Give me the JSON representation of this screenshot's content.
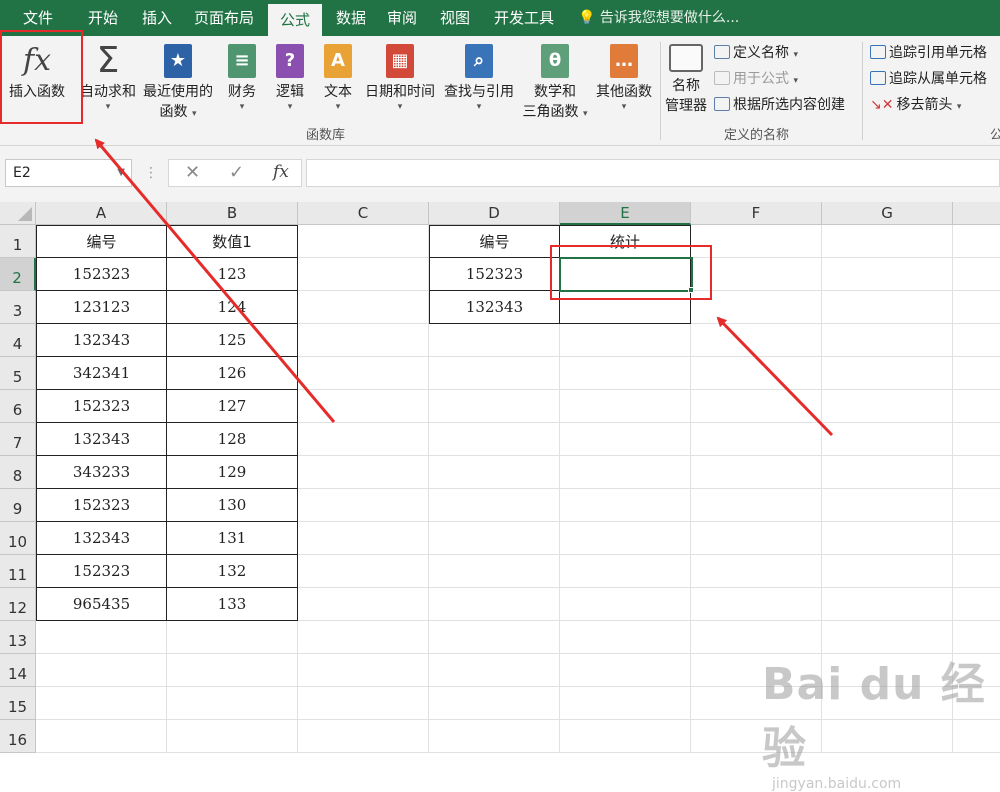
{
  "menu_tabs": [
    {
      "label": "文件"
    },
    {
      "label": "开始"
    },
    {
      "label": "插入"
    },
    {
      "label": "页面布局"
    },
    {
      "label": "公式",
      "active": true
    },
    {
      "label": "数据"
    },
    {
      "label": "审阅"
    },
    {
      "label": "视图"
    },
    {
      "label": "开发工具"
    }
  ],
  "tell_me": "告诉我您想要做什么...",
  "ribbon": {
    "function_library": {
      "group_label": "函数库",
      "insert_function": "插入函数",
      "insert_function_icon": "fx",
      "autosum": "自动求和",
      "recently_used_line1": "最近使用的",
      "recently_used_line2": "函数",
      "financial": "财务",
      "logical": "逻辑",
      "text": "文本",
      "datetime": "日期和时间",
      "lookup": "查找与引用",
      "math_line1": "数学和",
      "math_line2": "三角函数",
      "more": "其他函数"
    },
    "defined_names": {
      "group_label": "定义的名称",
      "name_manager_line1": "名称",
      "name_manager_line2": "管理器",
      "define_name": "定义名称",
      "use_in_formula": "用于公式",
      "create_from_selection": "根据所选内容创建"
    },
    "auditing": {
      "trace_precedents": "追踪引用单元格",
      "trace_dependents": "追踪从属单元格",
      "remove_arrows": "移去箭头",
      "group_label_partial": "公"
    }
  },
  "formula_bar": {
    "name_box": "E2",
    "cancel": "✕",
    "enter": "✓",
    "fx": "fx",
    "formula": ""
  },
  "columns": [
    "A",
    "B",
    "C",
    "D",
    "E",
    "F",
    "G"
  ],
  "rows": [
    "1",
    "2",
    "3",
    "4",
    "5",
    "6",
    "7",
    "8",
    "9",
    "10",
    "11",
    "12",
    "13",
    "14",
    "15",
    "16"
  ],
  "table_ab": {
    "headers": [
      "编号",
      "数值1"
    ],
    "rows": [
      [
        "152323",
        "123"
      ],
      [
        "123123",
        "124"
      ],
      [
        "132343",
        "125"
      ],
      [
        "342341",
        "126"
      ],
      [
        "152323",
        "127"
      ],
      [
        "132343",
        "128"
      ],
      [
        "343233",
        "129"
      ],
      [
        "152323",
        "130"
      ],
      [
        "132343",
        "131"
      ],
      [
        "152323",
        "132"
      ],
      [
        "965435",
        "133"
      ]
    ]
  },
  "table_de": {
    "headers": [
      "编号",
      "统计"
    ],
    "rows": [
      [
        "152323",
        ""
      ],
      [
        "132343",
        ""
      ]
    ]
  },
  "selected_cell": "E2",
  "annotation_color": "#e62b2b",
  "accent_color": "#217346",
  "watermark": {
    "big": "Bai du 经验",
    "small": "jingyan.baidu.com"
  }
}
